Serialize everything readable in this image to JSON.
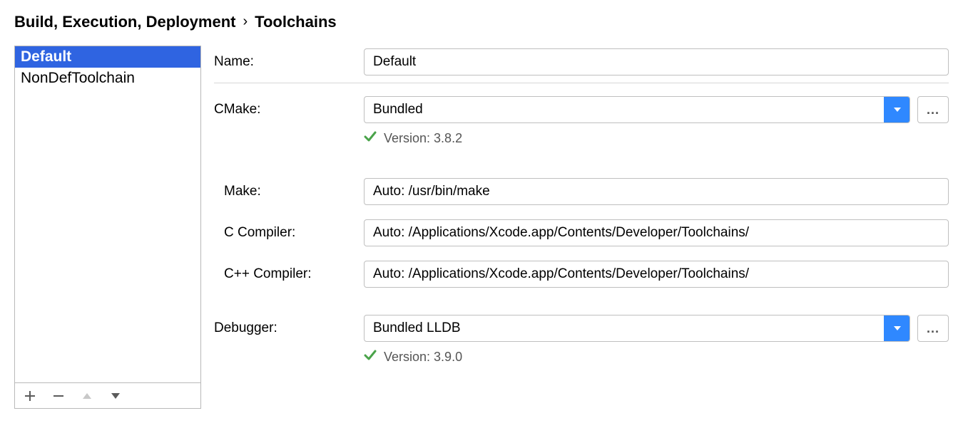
{
  "breadcrumb": {
    "level1": "Build, Execution, Deployment",
    "level2": "Toolchains"
  },
  "sidebar": {
    "items": [
      {
        "label": "Default",
        "selected": true
      },
      {
        "label": "NonDefToolchain",
        "selected": false
      }
    ],
    "toolbar": {
      "add": "+",
      "remove": "−",
      "up_disabled": true,
      "down_disabled": false
    }
  },
  "form": {
    "name": {
      "label": "Name:",
      "value": "Default"
    },
    "cmake": {
      "label": "CMake:",
      "value": "Bundled",
      "version_label": "Version: 3.8.2",
      "more": "..."
    },
    "make": {
      "label": "Make:",
      "value": "Auto: /usr/bin/make"
    },
    "c_compiler": {
      "label": "C Compiler:",
      "value": "Auto: /Applications/Xcode.app/Contents/Developer/Toolchains/"
    },
    "cpp_compiler": {
      "label": "C++ Compiler:",
      "value": "Auto: /Applications/Xcode.app/Contents/Developer/Toolchains/"
    },
    "debugger": {
      "label": "Debugger:",
      "value": "Bundled LLDB",
      "version_label": "Version: 3.9.0",
      "more": "..."
    }
  }
}
